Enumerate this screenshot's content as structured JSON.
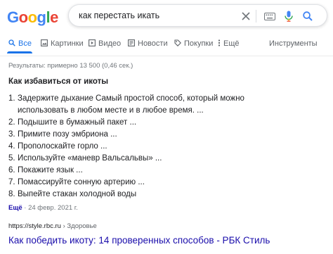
{
  "logo": {
    "letters": [
      "G",
      "o",
      "o",
      "g",
      "l",
      "e"
    ]
  },
  "search": {
    "query": "как перестать икать"
  },
  "tabs": [
    {
      "label": "Все",
      "icon": "search-icon",
      "active": true
    },
    {
      "label": "Картинки",
      "icon": "image-icon",
      "active": false
    },
    {
      "label": "Видео",
      "icon": "video-icon",
      "active": false
    },
    {
      "label": "Новости",
      "icon": "news-icon",
      "active": false
    },
    {
      "label": "Покупки",
      "icon": "tag-icon",
      "active": false
    },
    {
      "label": "Ещё",
      "icon": "more-vert-icon",
      "active": false
    }
  ],
  "tools_label": "Инструменты",
  "stats": "Результаты: примерно 13 500 (0,46 сек.)",
  "snippet": {
    "title": "Как избавиться от икоты",
    "items": [
      {
        "num": "1.",
        "text": "Задержите дыхание Самый простой способ, который можно использовать в любом месте и в любое время. ..."
      },
      {
        "num": "2.",
        "text": "Подышите в бумажный пакет ..."
      },
      {
        "num": "3.",
        "text": "Примите позу эмбриона ..."
      },
      {
        "num": "4.",
        "text": "Прополоскайте горло ..."
      },
      {
        "num": "5.",
        "text": "Используйте «маневр Вальсальвы» ..."
      },
      {
        "num": "6.",
        "text": "Покажите язык ..."
      },
      {
        "num": "7.",
        "text": "Помассируйте сонную артерию ..."
      },
      {
        "num": "8.",
        "text": "Выпейте стакан холодной воды"
      }
    ],
    "more_label": "Ещё",
    "date": "· 24 февр. 2021 г."
  },
  "result": {
    "url": "https://style.rbc.ru",
    "breadcrumb": "› Здоровье",
    "title": "Как победить икоту: 14 проверенных способов - РБК Стиль"
  },
  "colors": {
    "link": "#1a0dab",
    "accent": "#1a73e8",
    "muted": "#70757a"
  }
}
